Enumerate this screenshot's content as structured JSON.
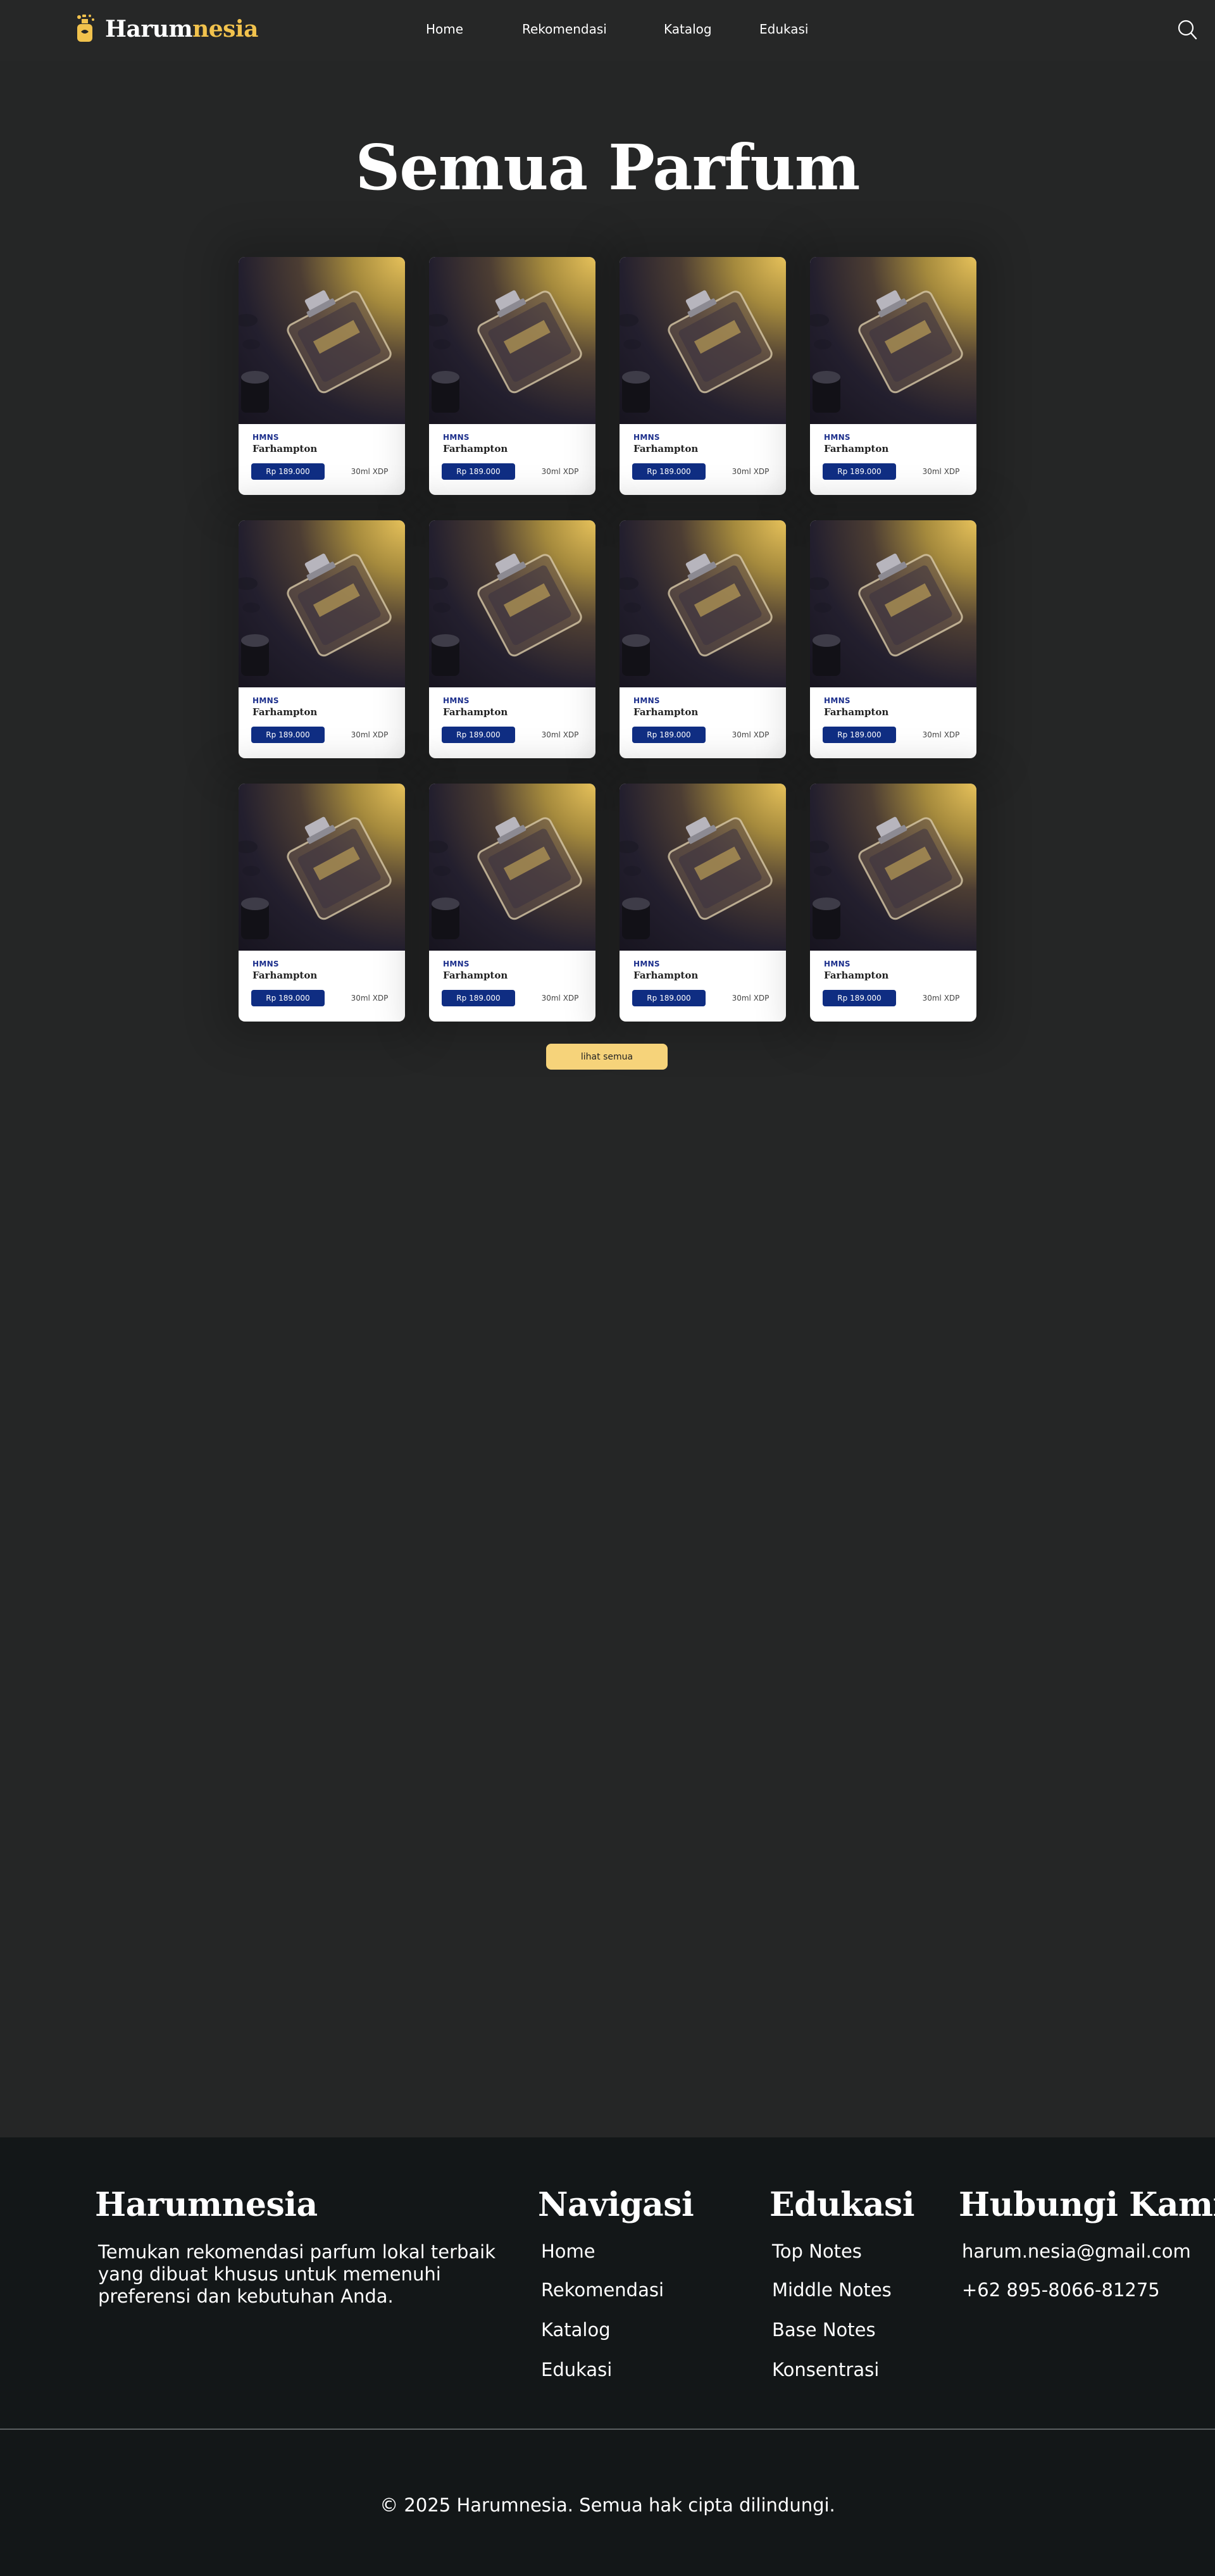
{
  "header": {
    "logo_part1": "Harum",
    "logo_part2": "nesia",
    "nav": [
      "Home",
      "Rekomendasi",
      "Katalog",
      "Edukasi"
    ],
    "search_icon": "search-icon"
  },
  "main": {
    "title": "Semua Parfum",
    "products": [
      {
        "brand": "HMNS",
        "name": "Farhampton",
        "price": "Rp 189.000",
        "size": "30ml XDP"
      },
      {
        "brand": "HMNS",
        "name": "Farhampton",
        "price": "Rp 189.000",
        "size": "30ml XDP"
      },
      {
        "brand": "HMNS",
        "name": "Farhampton",
        "price": "Rp 189.000",
        "size": "30ml XDP"
      },
      {
        "brand": "HMNS",
        "name": "Farhampton",
        "price": "Rp 189.000",
        "size": "30ml XDP"
      },
      {
        "brand": "HMNS",
        "name": "Farhampton",
        "price": "Rp 189.000",
        "size": "30ml XDP"
      },
      {
        "brand": "HMNS",
        "name": "Farhampton",
        "price": "Rp 189.000",
        "size": "30ml XDP"
      },
      {
        "brand": "HMNS",
        "name": "Farhampton",
        "price": "Rp 189.000",
        "size": "30ml XDP"
      },
      {
        "brand": "HMNS",
        "name": "Farhampton",
        "price": "Rp 189.000",
        "size": "30ml XDP"
      },
      {
        "brand": "HMNS",
        "name": "Farhampton",
        "price": "Rp 189.000",
        "size": "30ml XDP"
      },
      {
        "brand": "HMNS",
        "name": "Farhampton",
        "price": "Rp 189.000",
        "size": "30ml XDP"
      },
      {
        "brand": "HMNS",
        "name": "Farhampton",
        "price": "Rp 189.000",
        "size": "30ml XDP"
      },
      {
        "brand": "HMNS",
        "name": "Farhampton",
        "price": "Rp 189.000",
        "size": "30ml XDP"
      }
    ],
    "see_all": "lihat semua"
  },
  "footer": {
    "brand": "Harumnesia",
    "description": "Temukan rekomendasi parfum lokal terbaik yang dibuat khusus untuk memenuhi preferensi dan kebutuhan Anda.",
    "nav_title": "Navigasi",
    "nav_links": [
      "Home",
      "Rekomendasi",
      "Katalog",
      "Edukasi"
    ],
    "edu_title": "Edukasi",
    "edu_links": [
      "Top Notes",
      "Middle Notes",
      "Base Notes",
      "Konsentrasi"
    ],
    "contact_title": "Hubungi Kami",
    "email": "harum.nesia@gmail.com",
    "phone": "+62 895-8066-81275",
    "copyright": "© 2025 Harumnesia. Semua hak cipta dilindungi."
  },
  "colors": {
    "background": "#252626",
    "accent": "#f1c24d",
    "price_badge": "#0f2d82",
    "button": "#f6d37a",
    "footer": "#131718"
  }
}
